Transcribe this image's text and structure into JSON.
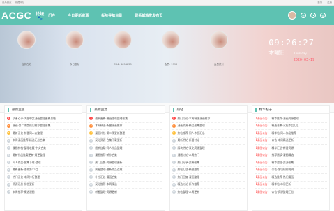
{
  "topbar": {
    "left": [
      "设为首页",
      "收藏本站"
    ],
    "right": [
      "登录",
      "注册"
    ]
  },
  "brand": {
    "logo": "ACGC",
    "sub": "论坛",
    "paw": "🐾"
  },
  "nav": {
    "items": [
      "门户",
      "今日更新资源",
      "板块导航目录",
      "联系邮箱发发布页"
    ]
  },
  "users": [
    {
      "name": "当前在线"
    },
    {
      "name": "今日发帖"
    },
    {
      "name": "CR4: 3694859"
    },
    {
      "name": "会员: 1990"
    },
    {
      "name": "会员统计"
    }
  ],
  "clock": {
    "time": "09:26:27",
    "day": "木曜日",
    "day_en": "Thursday",
    "date": "2020-03-19"
  },
  "subtabs": [
    "我的帖子",
    "最新回复"
  ],
  "columns": [
    {
      "title": "最新主题",
      "items": [
        "读者心评·大量中文漫画整理更新总结",
        "漫画·第二季度热门推荐整理合集",
        "最新汉化·新番同人志整理",
        "本周漫画推荐·精选汇总合集",
        "漫画补档·整理收藏·中文合集",
        "最新作品连载更新·周更整理",
        "同人作品·合集下载·整理",
        "最新更新·连载第12话",
        "热门汉化·本周排行整理",
        "资源汇总·补档更新",
        "本周推荐·精选漫画"
      ]
    },
    {
      "title": "最新回复",
      "items": [
        "最新更新·漫画连载整理合集",
        "本周精选·新番漫画推荐",
        "漫画补档·第二季更新整理",
        "汉化资源·合集下载更新",
        "最新连载·同人作品整理",
        "漫画推荐·新作合集",
        "热门回复·资源整理更新",
        "周更整理·最新作品连载",
        "补档汇总·漫画合集",
        "汉化推荐·本周精选",
        "新番整理·资源更新"
      ]
    },
    {
      "title": "热帖",
      "items": [
        "热门讨论·本周精选漫画推荐",
        "漫画资源·精品合集整理",
        "热帖推荐·同人作品汇总",
        "最新热帖·新番讨论",
        "版块热帖·汉化资源整理",
        "漫画讨论·本周热门",
        "热门分享·资源合集",
        "热帖汇总·精选推荐",
        "热门回复·漫画整理",
        "精选讨论·新作推荐",
        "热帖整理·本周更新"
      ]
    },
    {
      "title": "精华帖子",
      "tag": "【漫画公告】",
      "items": [
        "精华推荐·漫画资源整理",
        "精选合集·汉化作品汇总",
        "精华帖·同人作品推荐",
        "公告·本周精选更新",
        "精华汇总·新番资源",
        "推荐阅读·漫画精选",
        "精华整理·资源合集",
        "公告·版块规则说明",
        "精选推荐·热门漫画",
        "精华帖·本周更新",
        "公告·资源整理汇总"
      ]
    }
  ],
  "colors": {
    "primary": "#5ec2b2",
    "hot": "#ff4b4b",
    "date": "#ff5a6b"
  }
}
